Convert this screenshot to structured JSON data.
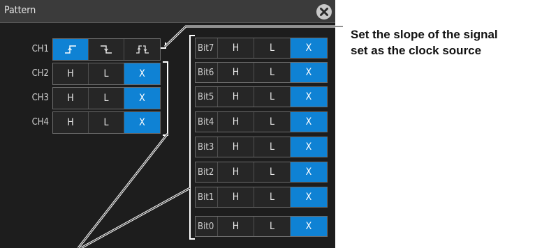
{
  "dialog": {
    "title": "Pattern",
    "close_icon": "close-icon"
  },
  "channels": [
    {
      "label": "CH1",
      "options": [
        "rising-edge-icon",
        "falling-edge-icon",
        "both-edges-icon"
      ],
      "selected": 0
    },
    {
      "label": "CH2",
      "options": [
        "H",
        "L",
        "X"
      ],
      "selected": 2
    },
    {
      "label": "CH3",
      "options": [
        "H",
        "L",
        "X"
      ],
      "selected": 2
    },
    {
      "label": "CH4",
      "options": [
        "H",
        "L",
        "X"
      ],
      "selected": 2
    }
  ],
  "bits": [
    {
      "label": "Bit7",
      "options": [
        "H",
        "L",
        "X"
      ],
      "selected": 2
    },
    {
      "label": "Bit6",
      "options": [
        "H",
        "L",
        "X"
      ],
      "selected": 2
    },
    {
      "label": "Bit5",
      "options": [
        "H",
        "L",
        "X"
      ],
      "selected": 2
    },
    {
      "label": "Bit4",
      "options": [
        "H",
        "L",
        "X"
      ],
      "selected": 2
    },
    {
      "label": "Bit3",
      "options": [
        "H",
        "L",
        "X"
      ],
      "selected": 2
    },
    {
      "label": "Bit2",
      "options": [
        "H",
        "L",
        "X"
      ],
      "selected": 2
    },
    {
      "label": "Bit1",
      "options": [
        "H",
        "L",
        "X"
      ],
      "selected": 2
    },
    {
      "label": "Bit0",
      "options": [
        "H",
        "L",
        "X"
      ],
      "selected": 2
    }
  ],
  "callout": {
    "line1": "Set the slope of the signal",
    "line2": "set as the clock source"
  },
  "colors": {
    "selected": "#0f82d4",
    "background": "#1d1d1d"
  }
}
